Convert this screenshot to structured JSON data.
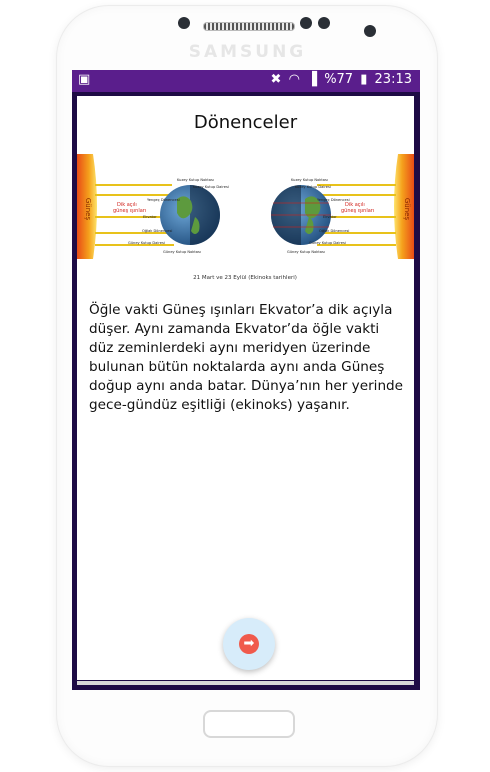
{
  "device": {
    "brand": "SAMSUNG"
  },
  "status_bar": {
    "left_icon": "image-notification-icon",
    "mute_icon": "vibrate-mute-icon",
    "wifi_icon": "wifi-icon",
    "signal_icon": "signal-icon",
    "battery_text": "%77",
    "battery_icon": "battery-icon",
    "time": "23:13"
  },
  "page": {
    "title": "Dönenceler",
    "body": "Öğle vakti Güneş ışınları Ekvator’a dik açıyla düşer. Aynı zamanda Ekvator’da öğle vakti düz zeminlerdeki aynı meridyen üzerinde bulunan bütün noktalarda aynı anda Güneş doğup aynı anda batar. Dünya’nın her yerinde gece-gündüz eşitliği (ekinoks) yaşanır."
  },
  "diagram": {
    "caption": "21 Mart ve 23 Eylül (Ekinoks tarihleri)",
    "sun_label": "Güneş",
    "red_label_line1": "Dik açılı",
    "red_label_line2": "güneş ışınları",
    "left_labels": [
      "Kuzey Kutup Noktası",
      "Kuzey Kutup Dairesi",
      "Yengeç Dönencesi",
      "Ekvator",
      "Oğlak Dönencesi",
      "Güney Kutup Dairesi",
      "Güney Kutup Noktası"
    ],
    "right_labels": [
      "Kuzey Kutup Noktası",
      "Kuzey Kutup Dairesi",
      "Yengeç Dönencesi",
      "Ekvator",
      "Oğlak Dönencesi",
      "Güney Kutup Dairesi",
      "Güney Kutup Noktası"
    ]
  },
  "fab": {
    "icon": "arrow-right-icon"
  },
  "colors": {
    "status_bar": "#5a1e8c",
    "screen_bg": "#1e0b45",
    "fab_bg": "#d7ecfa",
    "fab_icon": "#f05a4c",
    "ray": "#e8c21a",
    "sun": "#f5a21c"
  }
}
